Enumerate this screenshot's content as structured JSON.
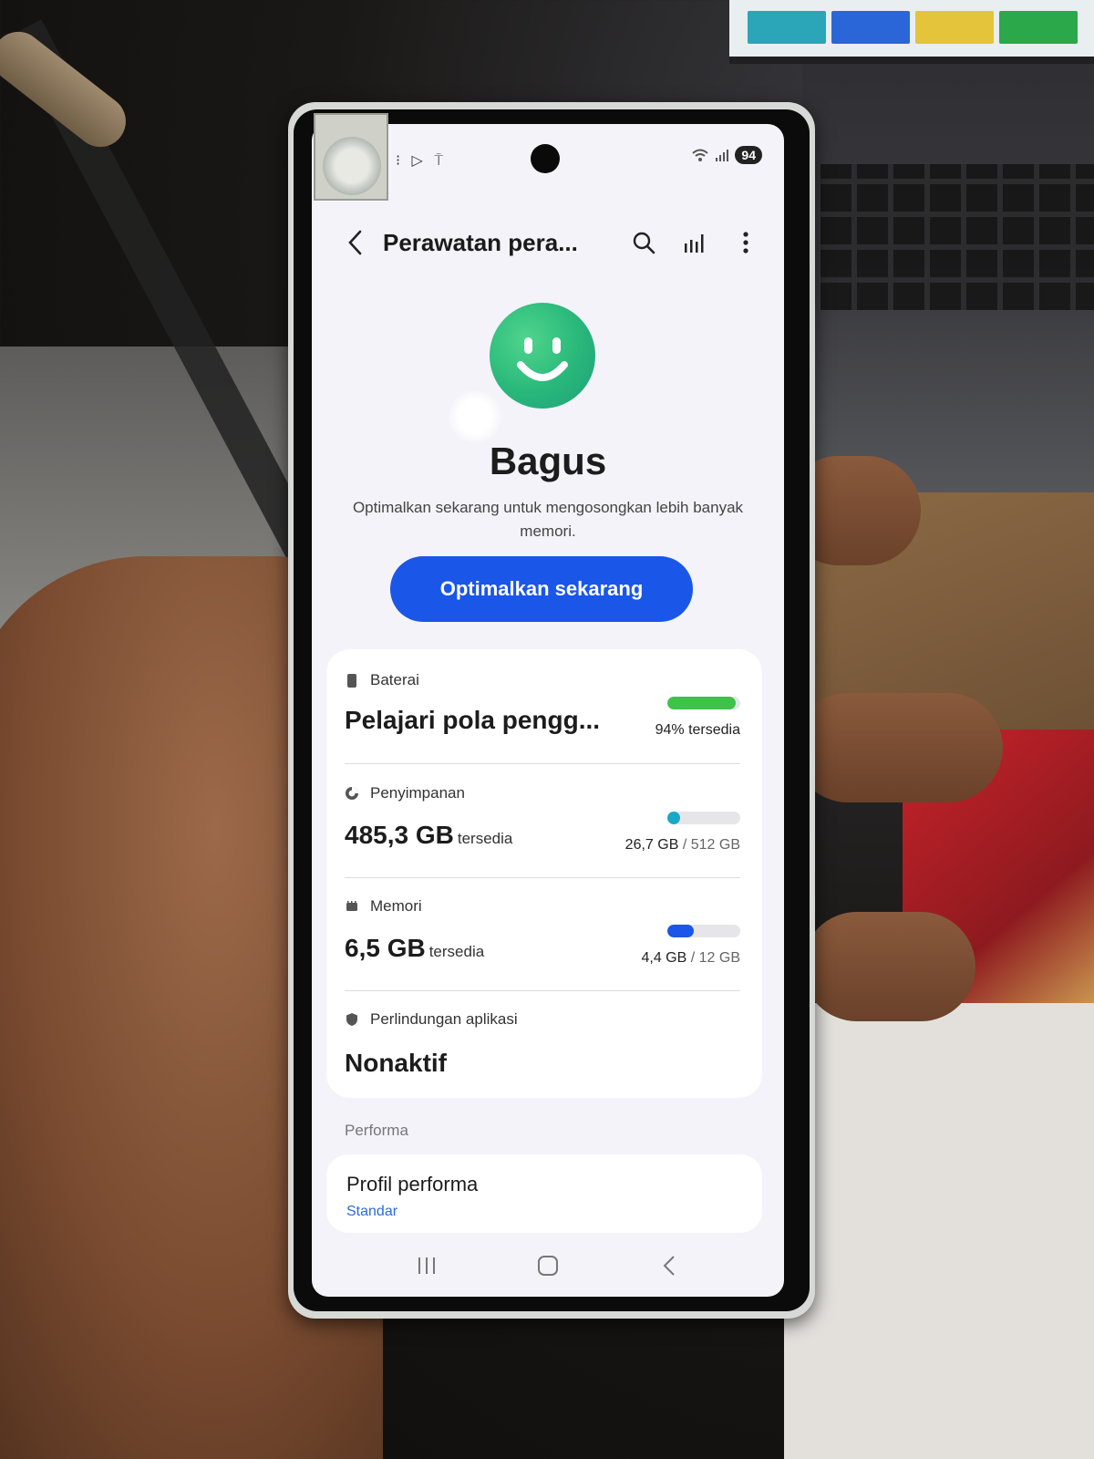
{
  "status_bar": {
    "left_icons": [
      "msg-icon",
      "play-icon",
      "signal-icon"
    ],
    "battery_level": "94"
  },
  "app_bar": {
    "title": "Perawatan pera...",
    "actions": [
      "search-icon",
      "chart-icon",
      "more-icon"
    ]
  },
  "hero": {
    "status": "Bagus",
    "description": "Optimalkan sekarang untuk mengosongkan lebih banyak memori.",
    "button_label": "Optimalkan sekarang"
  },
  "battery": {
    "label": "Baterai",
    "main": "Pelajari pola pengg...",
    "available_text": "94% tersedia",
    "fraction_available": 0.94,
    "color": "#3ec24a"
  },
  "storage": {
    "label": "Penyimpanan",
    "value": "485,3 GB",
    "value_suffix": "tersedia",
    "used": "26,7 GB",
    "separator": "/",
    "total": "512 GB",
    "fraction_used": 0.052,
    "color": "#17a9c9"
  },
  "memory": {
    "label": "Memori",
    "value": "6,5 GB",
    "value_suffix": "tersedia",
    "used": "4,4 GB",
    "separator": "/",
    "total": "12 GB",
    "fraction_used": 0.367,
    "color": "#1a56e8"
  },
  "app_protection": {
    "label": "Perlindungan aplikasi",
    "state": "Nonaktif"
  },
  "performance": {
    "section_header": "Performa",
    "item_title": "Profil performa",
    "item_value": "Standar"
  },
  "nav": [
    "recents-icon",
    "home-icon",
    "back-icon"
  ],
  "colors": {
    "accent": "#1a56e8",
    "face": "#28b77a",
    "background": "#f4f3f9"
  }
}
